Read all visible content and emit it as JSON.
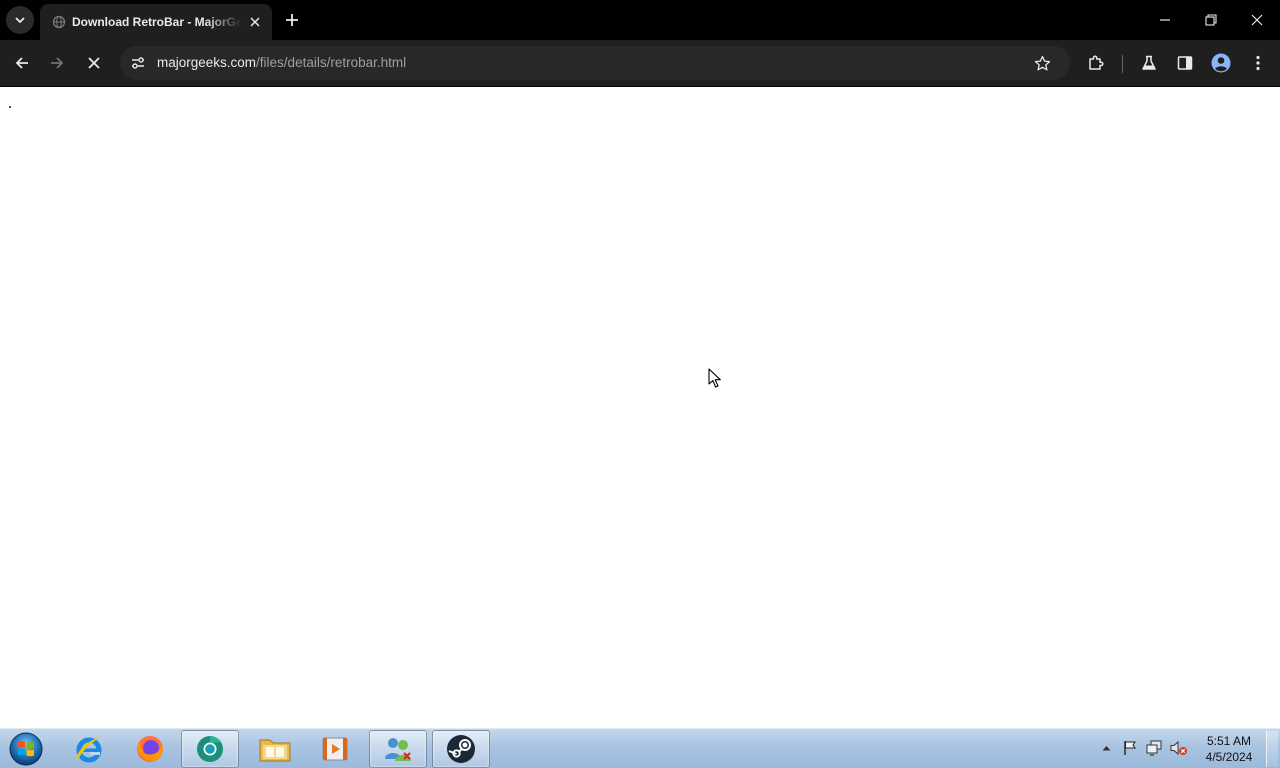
{
  "browser": {
    "tab": {
      "title": "Download RetroBar - MajorGeeks"
    },
    "address_bar": {
      "host": "majorgeeks.com",
      "path": "/files/details/retrobar.html"
    },
    "loading": true
  },
  "icons": {
    "tab_search": "chevron-down-icon",
    "favicon": "globe-icon",
    "tab_close": "close-icon",
    "new_tab": "plus-icon",
    "minimize": "minimize-icon",
    "restore": "restore-icon",
    "close": "close-icon",
    "back": "arrow-left-icon",
    "forward": "arrow-right-icon",
    "stop": "stop-icon",
    "site_info": "tune-icon",
    "bookmark": "star-icon",
    "extensions": "puzzle-icon",
    "labs": "flask-icon",
    "side_panel": "side-panel-icon",
    "profile": "profile-icon",
    "menu": "kebab-menu-icon"
  },
  "taskbar": {
    "pinned": [
      {
        "name": "Internet Explorer",
        "icon": "internet-explorer-icon",
        "active": false
      },
      {
        "name": "Firefox",
        "icon": "firefox-icon",
        "active": false
      },
      {
        "name": "Chrome",
        "icon": "chrome-icon",
        "active": true
      },
      {
        "name": "Windows Explorer",
        "icon": "folder-icon",
        "active": false
      },
      {
        "name": "Media Player",
        "icon": "media-player-icon",
        "active": false
      },
      {
        "name": "Users",
        "icon": "users-icon",
        "active": true
      },
      {
        "name": "Steam",
        "icon": "steam-icon",
        "active": true
      }
    ],
    "clock": {
      "time": "5:51 AM",
      "date": "4/5/2024"
    }
  },
  "colors": {
    "browser_frame": "#000000",
    "toolbar": "#1f1f1f",
    "omnibox": "#282828",
    "taskbar": "#a9c4e1"
  }
}
